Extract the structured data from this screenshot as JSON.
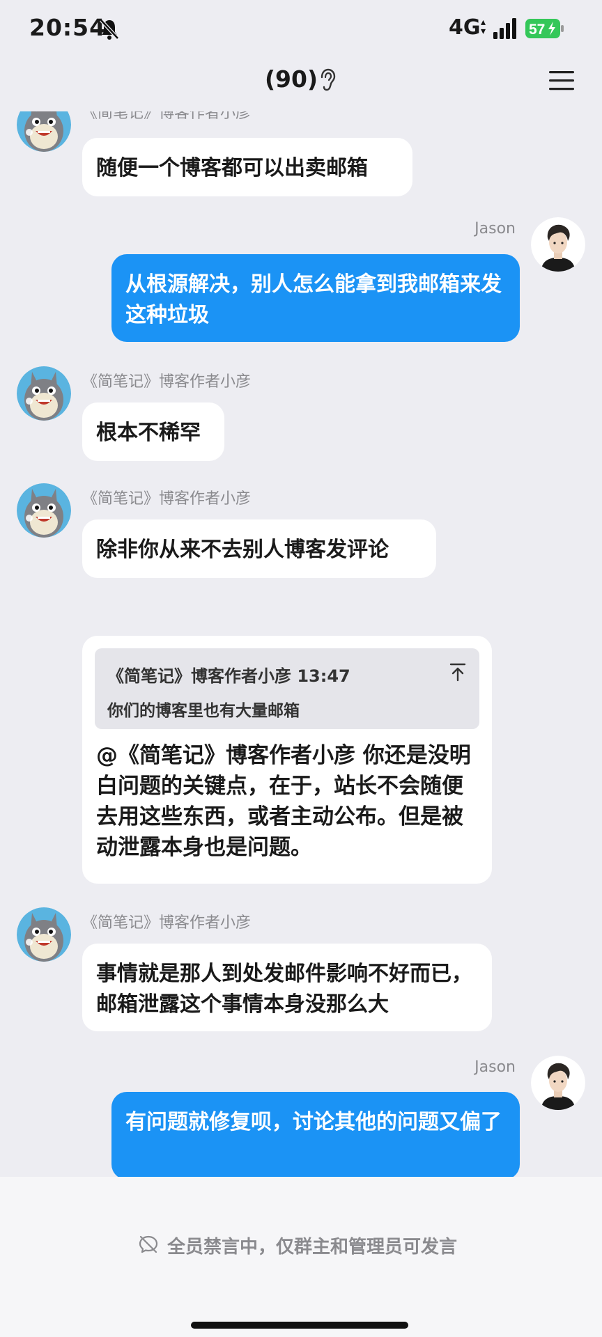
{
  "status_bar": {
    "time": "20:54",
    "network": "4G",
    "battery": "57"
  },
  "header": {
    "member_count": "(90)"
  },
  "messages": [
    {
      "sender": "《简笔记》博客作者小彦",
      "text": "随便一个博客都可以出卖邮箱"
    },
    {
      "sender": "Jason",
      "text": "从根源解决，别人怎么能拿到我邮箱来发这种垃圾"
    },
    {
      "sender": "《简笔记》博客作者小彦",
      "text": "根本不稀罕"
    },
    {
      "sender": "《简笔记》博客作者小彦",
      "text": "除非你从来不去别人博客发评论"
    },
    {
      "quote": {
        "author_time": "《简笔记》博客作者小彦 13:47",
        "text": "你们的博客里也有大量邮箱"
      },
      "text": "@《简笔记》博客作者小彦 你还是没明白问题的关键点，在于，站长不会随便去用这些东西，或者主动公布。但是被动泄露本身也是问题。"
    },
    {
      "sender": "《简笔记》博客作者小彦",
      "text": "事情就是那人到处发邮件影响不好而已，邮箱泄露这个事情本身没那么大"
    },
    {
      "sender": "Jason",
      "text": "有问题就修复呗，讨论其他的问题又偏了"
    }
  ],
  "footer": {
    "muted_notice": "全员禁言中，仅群主和管理员可发言"
  },
  "colors": {
    "outgoing_bubble": "#1b93f5",
    "incoming_bubble": "#ffffff",
    "background": "#ededf2"
  }
}
